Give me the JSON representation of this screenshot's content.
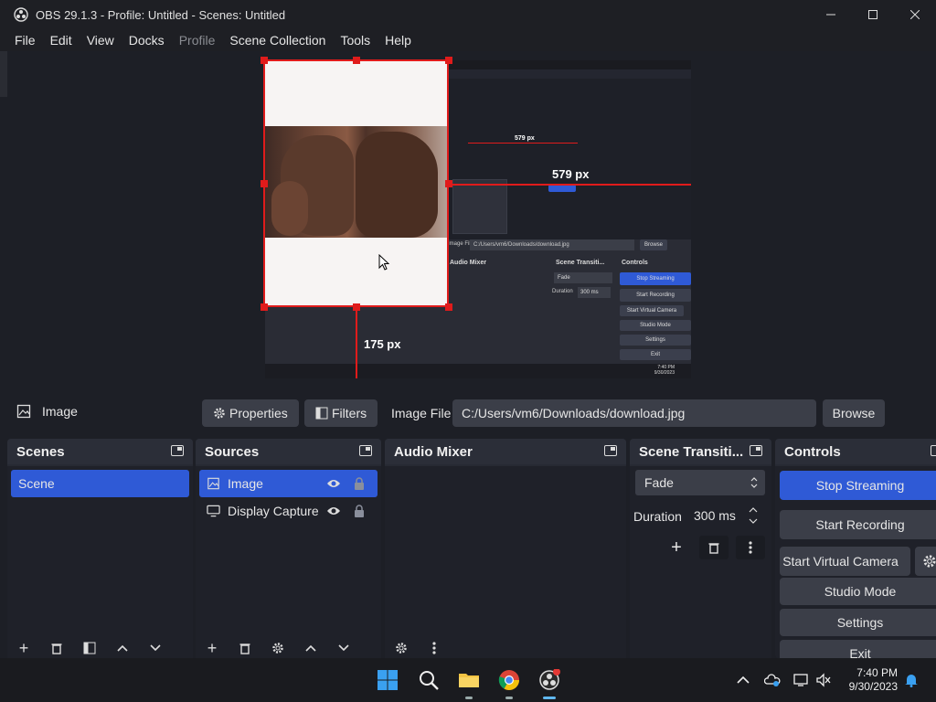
{
  "window": {
    "title": "OBS 29.1.3 - Profile: Untitled - Scenes: Untitled"
  },
  "menu": {
    "items": [
      "File",
      "Edit",
      "View",
      "Docks",
      "Profile",
      "Scene Collection",
      "Tools",
      "Help"
    ]
  },
  "preview": {
    "width_label": "579 px",
    "height_label": "175 px",
    "inner_width_label": "579 px"
  },
  "source_toolbar": {
    "source_name": "Image",
    "properties_label": "Properties",
    "filters_label": "Filters",
    "image_file_label": "Image File",
    "image_file_value": "C:/Users/vm6/Downloads/download.jpg",
    "browse_label": "Browse"
  },
  "scenes": {
    "title": "Scenes",
    "items": [
      "Scene"
    ]
  },
  "sources": {
    "title": "Sources",
    "items": [
      "Image",
      "Display Capture"
    ]
  },
  "audio_mixer": {
    "title": "Audio Mixer"
  },
  "transitions": {
    "title": "Scene Transiti...",
    "selected": "Fade",
    "duration_label": "Duration",
    "duration_value": "300 ms"
  },
  "controls": {
    "title": "Controls",
    "stop_streaming": "Stop Streaming",
    "start_recording": "Start Recording",
    "start_virtual_camera": "Start Virtual Camera",
    "studio_mode": "Studio Mode",
    "settings": "Settings",
    "exit": "Exit"
  },
  "mini_capture": {
    "image_file_label": "Image File",
    "image_file_value": "C:/Users/vm6/Downloads/download.jpg",
    "browse_label": "Browse",
    "audio_mixer": "Audio Mixer",
    "transitions": "Scene Transiti...",
    "controls": "Controls",
    "fade": "Fade",
    "duration": "Duration",
    "duration_value": "300 ms",
    "stop_streaming": "Stop Streaming",
    "start_recording": "Start Recording",
    "start_virtual": "Start Virtual Camera",
    "studio_mode": "Studio Mode",
    "settings": "Settings",
    "exit": "Exit",
    "clock_time": "7:40 PM",
    "clock_date": "9/30/2023"
  },
  "taskbar": {
    "time": "7:40 PM",
    "date": "9/30/2023"
  }
}
